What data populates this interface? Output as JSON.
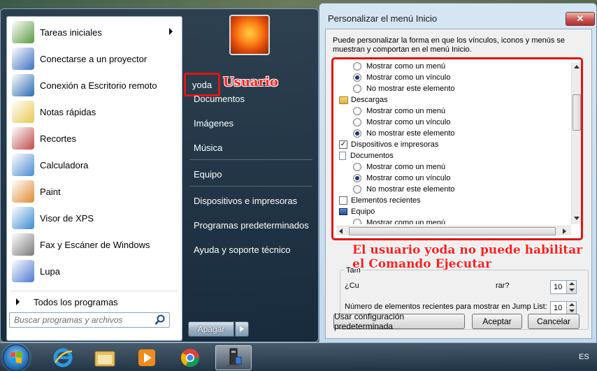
{
  "start_menu": {
    "programs": [
      {
        "label": "Tareas iniciales",
        "icon": "getting-started-icon",
        "has_submenu": true
      },
      {
        "label": "Conectarse a un proyector",
        "icon": "projector-icon"
      },
      {
        "label": "Conexión a Escritorio remoto",
        "icon": "remote-desktop-icon"
      },
      {
        "label": "Notas rápidas",
        "icon": "sticky-notes-icon"
      },
      {
        "label": "Recortes",
        "icon": "snipping-tool-icon"
      },
      {
        "label": "Calculadora",
        "icon": "calculator-icon"
      },
      {
        "label": "Paint",
        "icon": "paint-icon"
      },
      {
        "label": "Visor de XPS",
        "icon": "xps-viewer-icon"
      },
      {
        "label": "Fax y Escáner de Windows",
        "icon": "fax-scanner-icon"
      },
      {
        "label": "Lupa",
        "icon": "magnifier-icon"
      }
    ],
    "all_programs": "Todos los programas",
    "search_placeholder": "Buscar programas y archivos",
    "user": "yoda",
    "user_annotation": "Usuario",
    "right_items": [
      "Documentos",
      "Imágenes",
      "Música",
      "Equipo",
      "Dispositivos e impresoras",
      "Programas predeterminados",
      "Ayuda y soporte técnico"
    ],
    "shutdown_label": "Apagar"
  },
  "dialog": {
    "title": "Personalizar el menú Inicio",
    "close": "✕",
    "description": "Puede personalizar la forma en que los vínculos, iconos y menús se muestran y comportan en el menú Inicio.",
    "options": [
      {
        "kind": "radio",
        "label": "Mostrar como un menú",
        "checked": false
      },
      {
        "kind": "radio",
        "label": "Mostrar como un vínculo",
        "checked": true
      },
      {
        "kind": "radio",
        "label": "No mostrar este elemento",
        "checked": false
      },
      {
        "kind": "header",
        "label": "Descargas",
        "icon": "folder-icon"
      },
      {
        "kind": "radio",
        "label": "Mostrar como un menú",
        "checked": false
      },
      {
        "kind": "radio",
        "label": "Mostrar como un vínculo",
        "checked": false
      },
      {
        "kind": "radio",
        "label": "No mostrar este elemento",
        "checked": true
      },
      {
        "kind": "checkbox",
        "label": "Dispositivos e impresoras",
        "checked": true
      },
      {
        "kind": "header",
        "label": "Documentos",
        "icon": "document-icon"
      },
      {
        "kind": "radio",
        "label": "Mostrar como un menú",
        "checked": false
      },
      {
        "kind": "radio",
        "label": "Mostrar como un vínculo",
        "checked": true
      },
      {
        "kind": "radio",
        "label": "No mostrar este elemento",
        "checked": false
      },
      {
        "kind": "checkbox",
        "label": "Elementos recientes",
        "checked": false
      },
      {
        "kind": "header",
        "label": "Equipo",
        "icon": "computer-icon"
      },
      {
        "kind": "radio",
        "label": "Mostrar como un menú",
        "checked": false
      }
    ],
    "size_group_label": "Tam",
    "recent_programs_label": "¿Cu",
    "recent_programs_suffix": "rar?",
    "recent_programs_value": "10",
    "jumplist_label": "Número de elementos recientes para mostrar en Jump List:",
    "jumplist_value": "10",
    "annotation_line1": "El usuario yoda no puede habilitar",
    "annotation_line2": "el Comando Ejecutar",
    "btn_default": "Usar configuración predeterminada",
    "btn_ok": "Aceptar",
    "btn_cancel": "Cancelar"
  },
  "taskbar": {
    "items": [
      "internet-explorer-icon",
      "file-explorer-icon",
      "media-player-icon",
      "chrome-icon",
      "active-app-icon"
    ],
    "language": "ES"
  }
}
